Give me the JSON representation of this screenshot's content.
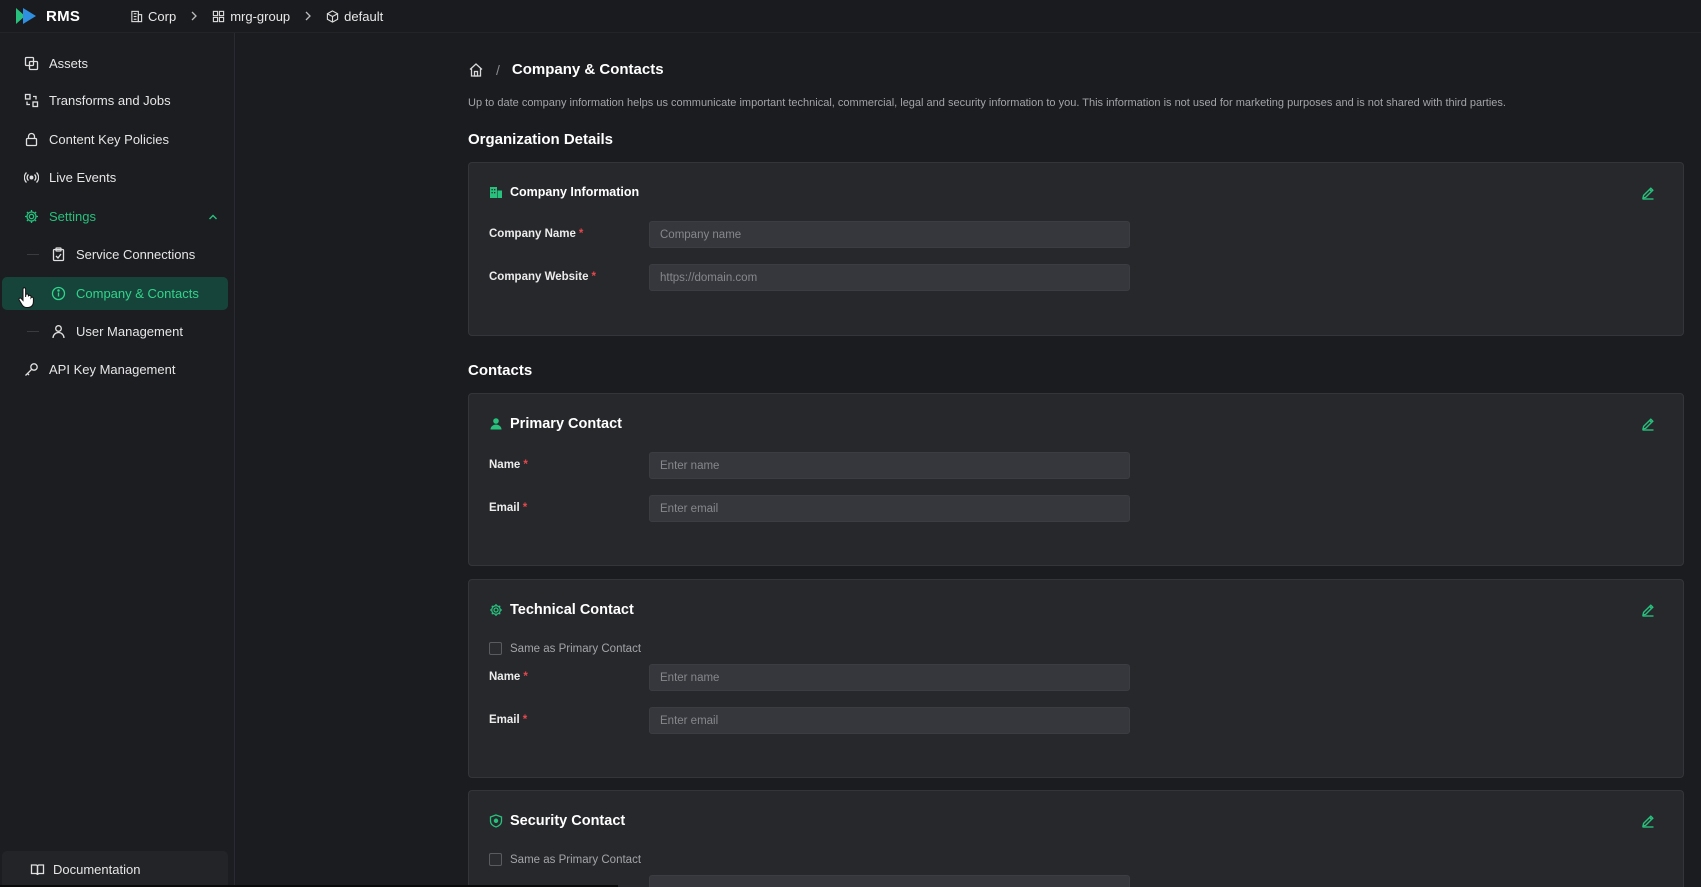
{
  "app": {
    "name": "RMS"
  },
  "breadcrumb": [
    {
      "label": "Corp",
      "icon": "building-icon"
    },
    {
      "label": "mrg-group",
      "icon": "grid-icon"
    },
    {
      "label": "default",
      "icon": "cube-icon"
    }
  ],
  "sidebar": {
    "items": [
      {
        "label": "Assets",
        "icon": "assets-icon"
      },
      {
        "label": "Transforms and Jobs",
        "icon": "transforms-icon"
      },
      {
        "label": "Content Key Policies",
        "icon": "lock-icon"
      },
      {
        "label": "Live Events",
        "icon": "broadcast-icon"
      },
      {
        "label": "Settings",
        "icon": "gear-icon",
        "expanded": true
      },
      {
        "label": "Service Connections",
        "icon": "clipboard-icon"
      },
      {
        "label": "Company & Contacts",
        "icon": "info-icon",
        "active": true
      },
      {
        "label": "User Management",
        "icon": "user-icon"
      },
      {
        "label": "API Key Management",
        "icon": "key-icon"
      }
    ],
    "documentation": "Documentation"
  },
  "page": {
    "title": "Company & Contacts",
    "intro": "Up to date company information helps us communicate important technical, commercial, legal and security information to you. This information is not used for marketing purposes and is not shared with third parties.",
    "org_section": "Organization Details",
    "contacts_section": "Contacts"
  },
  "company": {
    "title": "Company Information",
    "name_label": "Company Name",
    "name_placeholder": "Company name",
    "website_label": "Company Website",
    "website_placeholder": "https://domain.com"
  },
  "primary": {
    "title": "Primary Contact",
    "name_label": "Name",
    "name_placeholder": "Enter name",
    "email_label": "Email",
    "email_placeholder": "Enter email"
  },
  "technical": {
    "title": "Technical Contact",
    "same_as": "Same as Primary Contact",
    "name_label": "Name",
    "name_placeholder": "Enter name",
    "email_label": "Email",
    "email_placeholder": "Enter email"
  },
  "security": {
    "title": "Security Contact",
    "same_as": "Same as Primary Contact"
  },
  "colors": {
    "accent": "#27c07d",
    "active_bg": "#17443a",
    "required": "#e5484d"
  }
}
